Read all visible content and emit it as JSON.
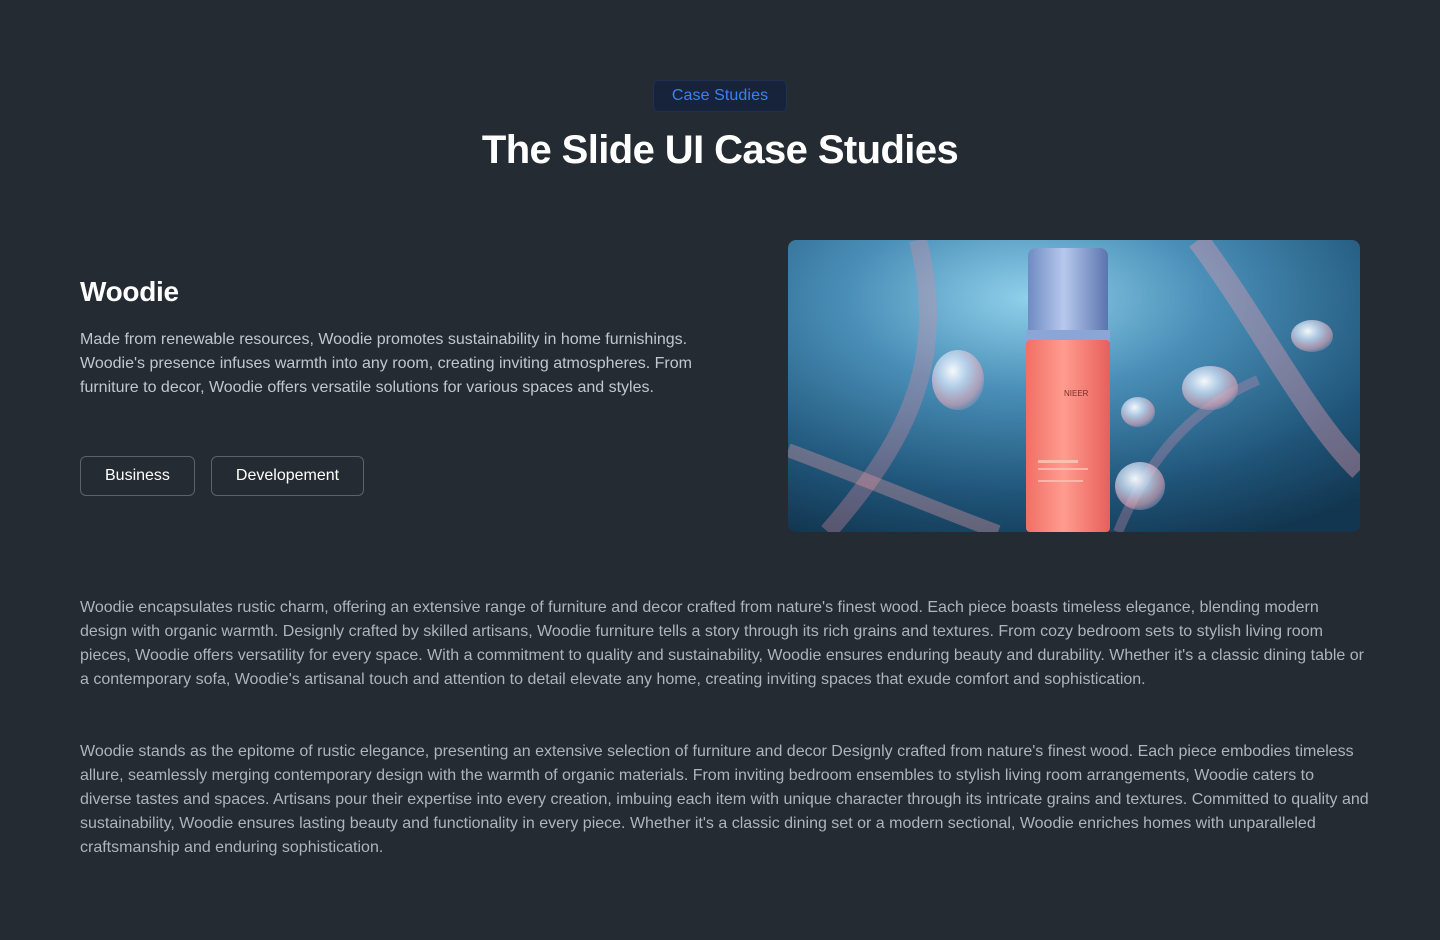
{
  "header": {
    "badge": "Case Studies",
    "title": "The Slide UI Case Studies"
  },
  "case": {
    "name": "Woodie",
    "summary": "Made from renewable resources, Woodie promotes sustainability in home furnishings. Woodie's presence infuses warmth into any room, creating inviting atmospheres. From furniture to decor, Woodie offers versatile solutions for various spaces and styles.",
    "tags": [
      "Business",
      "Developement"
    ],
    "image": {
      "icon": "product-bottle-image",
      "bottle_label": "NIEER"
    }
  },
  "details": {
    "paragraph1": "Woodie encapsulates rustic charm, offering an extensive range of furniture and decor crafted from nature's finest wood. Each piece boasts timeless elegance, blending modern design with organic warmth. Designly crafted by skilled artisans, Woodie furniture tells a story through its rich grains and textures. From cozy bedroom sets to stylish living room pieces, Woodie offers versatility for every space. With a commitment to quality and sustainability, Woodie ensures enduring beauty and durability. Whether it's a classic dining table or a contemporary sofa, Woodie's artisanal touch and attention to detail elevate any home, creating inviting spaces that exude comfort and sophistication.",
    "paragraph2": "Woodie stands as the epitome of rustic elegance, presenting an extensive selection of furniture and decor Designly crafted from nature's finest wood. Each piece embodies timeless allure, seamlessly merging contemporary design with the warmth of organic materials. From inviting bedroom ensembles to stylish living room arrangements, Woodie caters to diverse tastes and spaces. Artisans pour their expertise into every creation, imbuing each item with unique character through its intricate grains and textures. Committed to quality and sustainability, Woodie ensures lasting beauty and functionality in every piece. Whether it's a classic dining set or a modern sectional, Woodie enriches homes with unparalleled craftsmanship and enduring sophistication."
  },
  "colors": {
    "background": "#252b32",
    "accent": "#3b82f6",
    "badge_bg": "#17233a"
  }
}
